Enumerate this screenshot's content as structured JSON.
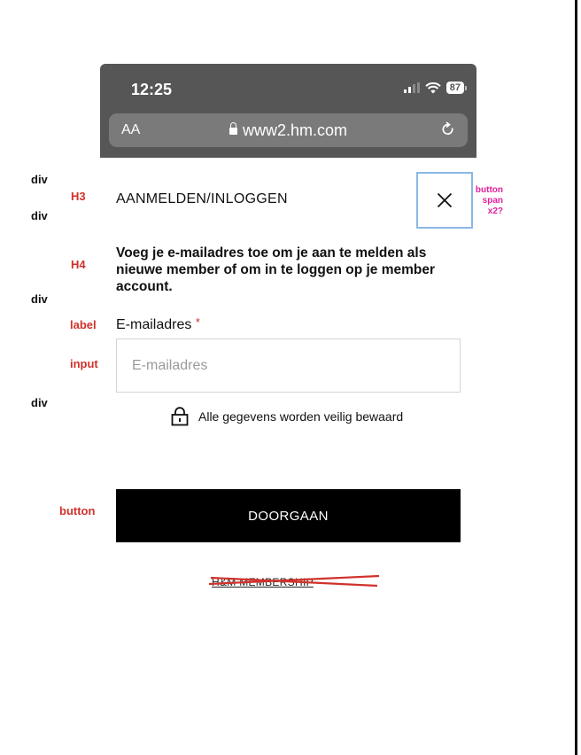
{
  "browser": {
    "time": "12:25",
    "battery": "87",
    "text_size_button": "AA",
    "url": "www2.hm.com"
  },
  "annotations": {
    "div_1": "div",
    "div_2": "div",
    "div_3": "div",
    "div_4": "div",
    "h3": "H3",
    "h4": "H4",
    "label": "label",
    "input": "input",
    "button": "button",
    "close_note": "button\nspan\nx2?"
  },
  "dialog": {
    "title": "AANMELDEN/INLOGGEN",
    "subtitle": "Voeg je e-mailadres toe om je aan te melden als nieuwe member of om in te loggen op je member account.",
    "email_label": "E-mailadres",
    "required_mark": "*",
    "email_placeholder": "E-mailadres",
    "email_value": "",
    "security_note": "Alle gegevens worden veilig bewaard",
    "continue_button": "DOORGAAN",
    "membership_link": "H&M MEMBERSHIP"
  },
  "colors": {
    "annotation_red": "#d0322b",
    "annotation_pink": "#e0219c",
    "highlight_blue": "#8ab8e6",
    "button_black": "#000000"
  }
}
